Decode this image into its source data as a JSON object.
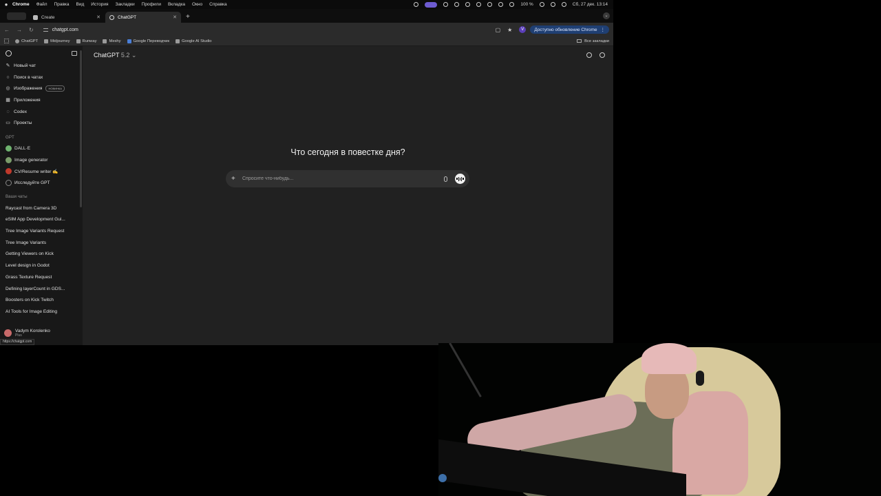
{
  "menubar": {
    "app": "Chrome",
    "items": [
      "Файл",
      "Правка",
      "Вид",
      "История",
      "Закладки",
      "Профили",
      "Вкладка",
      "Окно",
      "Справка"
    ],
    "battery": "100 %",
    "datetime": "Сб, 27 дек.  13:14"
  },
  "tabs": [
    {
      "title": "Create"
    },
    {
      "title": "ChatGPT"
    }
  ],
  "toolbar": {
    "url": "chatgpt.com",
    "profile_initial": "V",
    "update_label": "Доступно обновление Chrome"
  },
  "bookmarks": {
    "items": [
      "ChatGPT",
      "Midjourney",
      "Runway",
      "Meshy",
      "Google Переводчик",
      "Google AI Studio"
    ],
    "all_label": "Все закладки"
  },
  "sidebar": {
    "nav": [
      {
        "label": "Новый чат",
        "icon": "edit-icon"
      },
      {
        "label": "Поиск в чатах",
        "icon": "search-icon"
      },
      {
        "label": "Изображения",
        "icon": "image-icon",
        "badge": "НОВИНКА"
      },
      {
        "label": "Приложения",
        "icon": "apps-icon"
      },
      {
        "label": "Codex",
        "icon": "codex-icon"
      },
      {
        "label": "Проекты",
        "icon": "folder-icon"
      }
    ],
    "gpt_header": "GPT",
    "gpts": [
      {
        "label": "DALL·E",
        "color": "#6fb36f"
      },
      {
        "label": "Image generator",
        "color": "#7a9c6a"
      },
      {
        "label": "CV/Resume writer ✍️",
        "color": "#c0392b"
      },
      {
        "label": "Исследуйте GPT",
        "color": "#888888"
      }
    ],
    "chats_header": "Ваши чаты",
    "chats": [
      "Raycast from Camera 3D",
      "eSIM App Development Gui...",
      "Tree Image Variants Request",
      "Tree Image Variants",
      "Getting Viewers on Kick",
      "Level design in Godot",
      "Grass Texture Request",
      "Defining layerCount in GDS...",
      "Boosters on Kick Twitch",
      "AI Tools for Image Editing"
    ],
    "user": {
      "name": "Vadym Korolenko",
      "plan": "Plus"
    }
  },
  "main": {
    "model_name": "ChatGPT",
    "model_version": "5.2",
    "heading": "Что сегодня в повестке дня?",
    "composer_placeholder": "Спросите что-нибудь..."
  },
  "status_url": "https://chatgpt.com"
}
